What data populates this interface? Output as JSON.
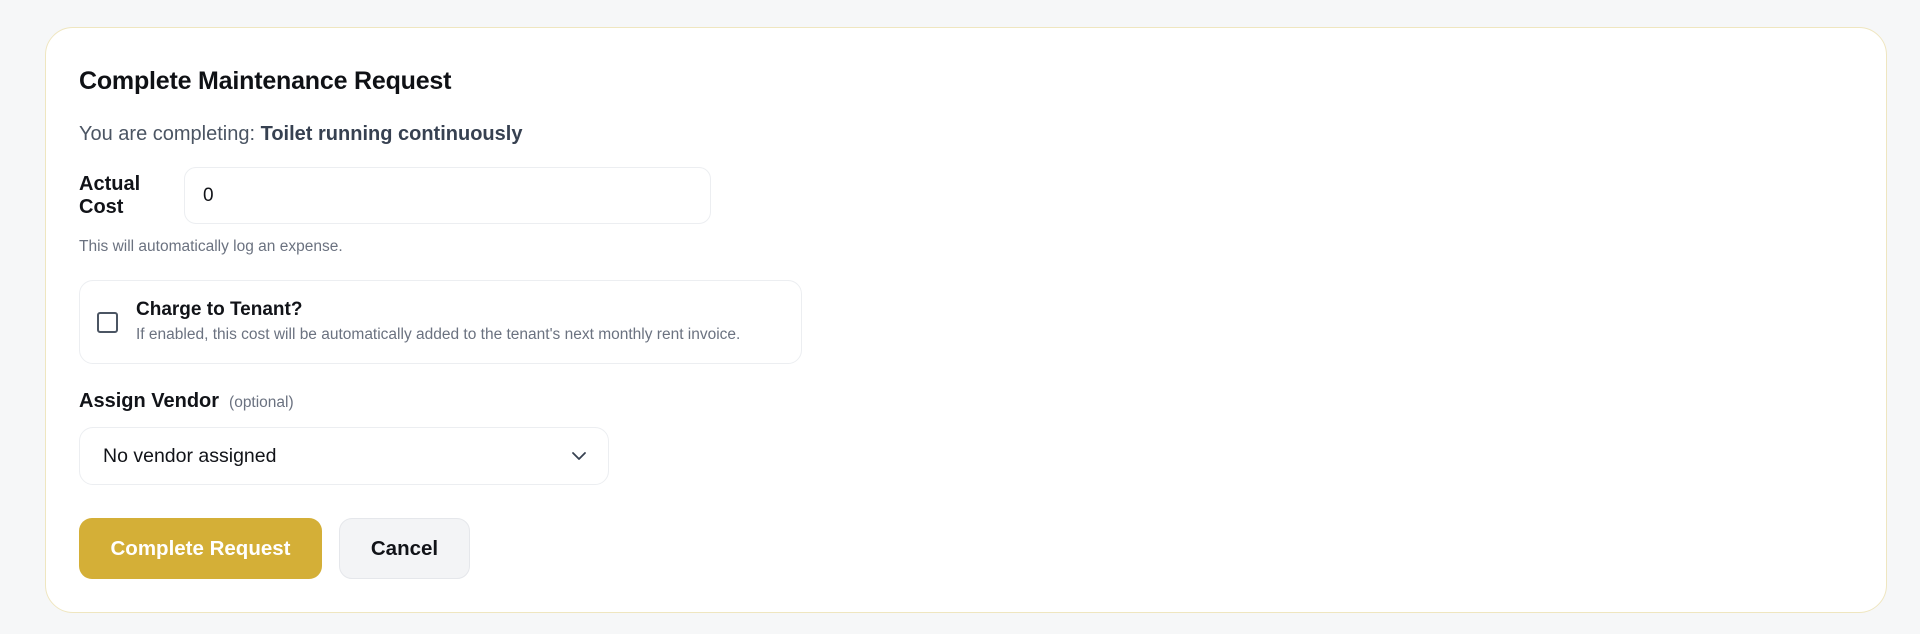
{
  "dialog": {
    "title": "Complete Maintenance Request",
    "subtitle_prefix": "You are completing:",
    "request_name": "Toilet running continuously"
  },
  "cost": {
    "label": "Actual Cost",
    "value": "0",
    "hint": "This will automatically log an expense."
  },
  "charge": {
    "checked": false,
    "title": "Charge to Tenant?",
    "description": "If enabled, this cost will be automatically added to the tenant's next monthly rent invoice."
  },
  "vendor": {
    "label": "Assign Vendor",
    "optional_tag": "(optional)",
    "selected": "No vendor assigned",
    "icon": "chevron-down-icon"
  },
  "actions": {
    "primary_label": "Complete Request",
    "secondary_label": "Cancel"
  },
  "colors": {
    "accent": "#d4af37",
    "card_border": "#efe6c0",
    "background": "#f6f7f8"
  }
}
